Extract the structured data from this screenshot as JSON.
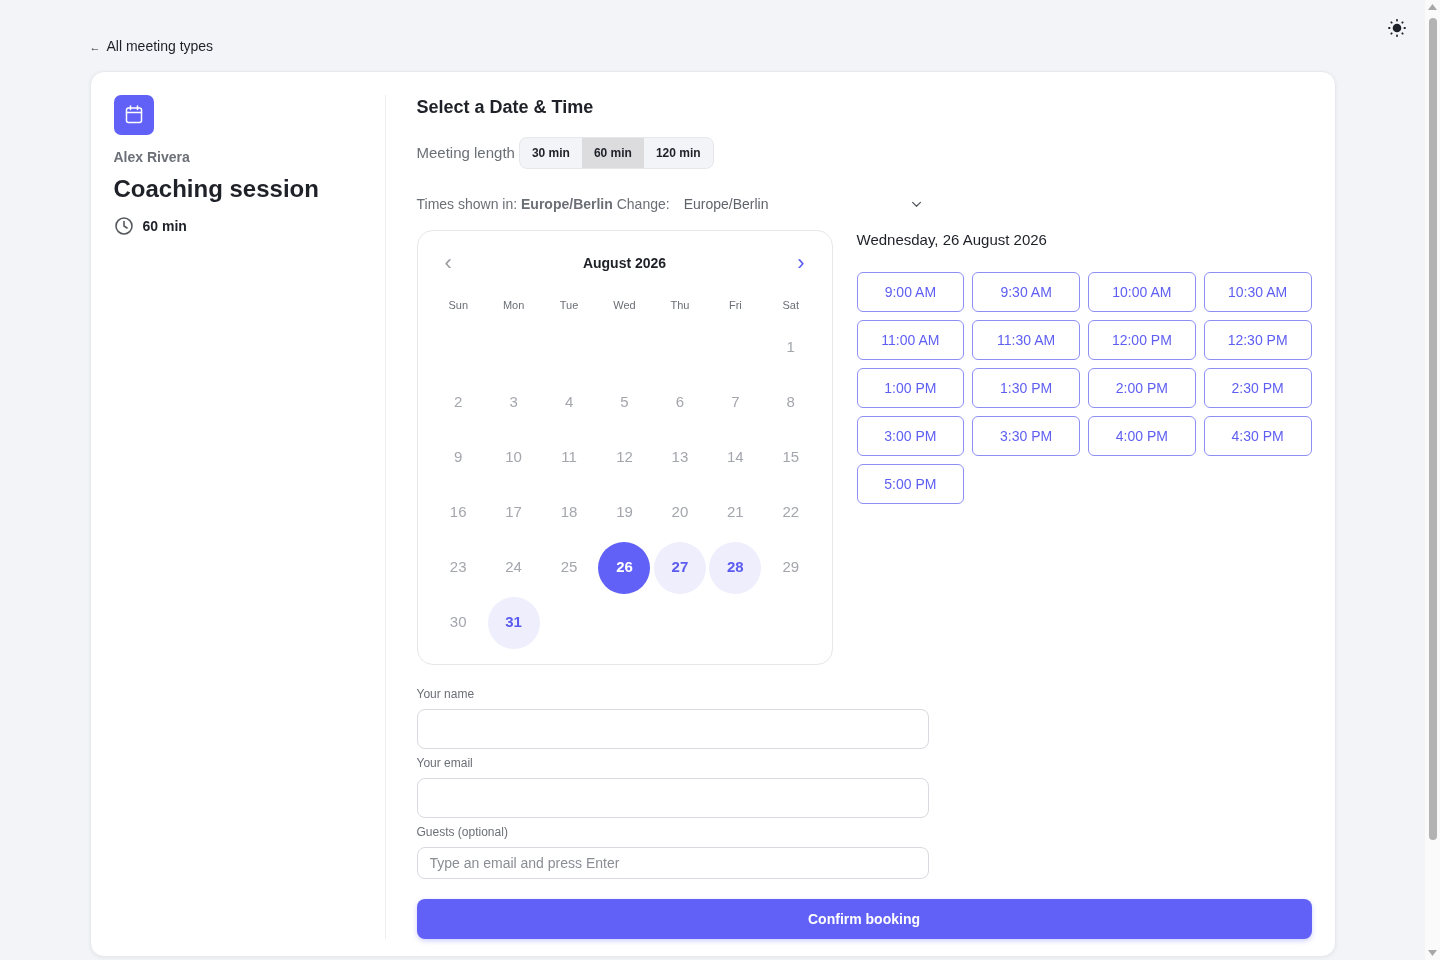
{
  "back_link": {
    "arrow": "←",
    "label": "All meeting types"
  },
  "event": {
    "host": "Alex Rivera",
    "title": "Coaching session",
    "duration": "60 min"
  },
  "scheduler": {
    "title": "Select a Date & Time",
    "length_label": "Meeting length",
    "lengths": [
      {
        "label": "30 min",
        "selected": false
      },
      {
        "label": "60 min",
        "selected": true
      },
      {
        "label": "120 min",
        "selected": false
      }
    ],
    "timezone_note": "Times shown in: **Europe/Berlin** Change:",
    "timezone_value": "Europe/Berlin"
  },
  "calendar": {
    "month": "August 2026",
    "prev": {
      "symbol": "‹",
      "disabled": true
    },
    "next": {
      "symbol": "›",
      "disabled": false
    },
    "weekdays": [
      "Sun",
      "Mon",
      "Tue",
      "Wed",
      "Thu",
      "Fri",
      "Sat"
    ],
    "weeks": [
      [
        {
          "day": "1",
          "available": false,
          "selected": false
        }
      ],
      [
        {
          "day": "2",
          "available": false,
          "selected": false
        },
        {
          "day": "3",
          "available": false,
          "selected": false
        },
        {
          "day": "4",
          "available": false,
          "selected": false
        },
        {
          "day": "5",
          "available": false,
          "selected": false
        },
        {
          "day": "6",
          "available": false,
          "selected": false
        },
        {
          "day": "7",
          "available": false,
          "selected": false
        },
        {
          "day": "8",
          "available": false,
          "selected": false
        }
      ],
      [
        {
          "day": "9",
          "available": false,
          "selected": false
        },
        {
          "day": "10",
          "available": false,
          "selected": false
        },
        {
          "day": "11",
          "available": false,
          "selected": false
        },
        {
          "day": "12",
          "available": false,
          "selected": false
        },
        {
          "day": "13",
          "available": false,
          "selected": false
        },
        {
          "day": "14",
          "available": false,
          "selected": false
        },
        {
          "day": "15",
          "available": false,
          "selected": false
        }
      ],
      [
        {
          "day": "16",
          "available": false,
          "selected": false
        },
        {
          "day": "17",
          "available": false,
          "selected": false
        },
        {
          "day": "18",
          "available": false,
          "selected": false
        },
        {
          "day": "19",
          "available": false,
          "selected": false
        },
        {
          "day": "20",
          "available": false,
          "selected": false
        },
        {
          "day": "21",
          "available": false,
          "selected": false
        },
        {
          "day": "22",
          "available": false,
          "selected": false
        }
      ],
      [
        {
          "day": "23",
          "available": false,
          "selected": false
        },
        {
          "day": "24",
          "available": false,
          "selected": false
        },
        {
          "day": "25",
          "available": false,
          "selected": false
        },
        {
          "day": "26",
          "available": true,
          "selected": true
        },
        {
          "day": "27",
          "available": true,
          "selected": false
        },
        {
          "day": "28",
          "available": true,
          "selected": false
        },
        {
          "day": "29",
          "available": false,
          "selected": false
        }
      ],
      [
        {
          "day": "30",
          "available": false,
          "selected": false
        },
        {
          "day": "31",
          "available": true,
          "selected": false
        }
      ]
    ]
  },
  "slots": {
    "date": "Wednesday, 26 August 2026",
    "times": [
      {
        "label": "9:00 AM",
        "selected": false
      },
      {
        "label": "9:30 AM",
        "selected": false
      },
      {
        "label": "10:00 AM",
        "selected": false
      },
      {
        "label": "10:30 AM",
        "selected": false
      },
      {
        "label": "11:00 AM",
        "selected": false
      },
      {
        "label": "11:30 AM",
        "selected": false
      },
      {
        "label": "12:00 PM",
        "selected": false
      },
      {
        "label": "12:30 PM",
        "selected": false
      },
      {
        "label": "1:00 PM",
        "selected": false
      },
      {
        "label": "1:30 PM",
        "selected": false
      },
      {
        "label": "2:00 PM",
        "selected": false
      },
      {
        "label": "2:30 PM",
        "selected": false
      },
      {
        "label": "3:00 PM",
        "selected": false
      },
      {
        "label": "3:30 PM",
        "selected": false
      },
      {
        "label": "4:00 PM",
        "selected": false
      },
      {
        "label": "4:30 PM",
        "selected": false
      },
      {
        "label": "5:00 PM",
        "selected": false
      }
    ]
  },
  "form": {
    "fields": [
      {
        "kind": "text",
        "label": "Your name"
      },
      {
        "kind": "text",
        "label": "Your email"
      },
      {
        "kind": "tags",
        "label": "Guests (optional)",
        "placeholder": "Type an email and press Enter"
      }
    ],
    "submit": "Confirm booking"
  }
}
